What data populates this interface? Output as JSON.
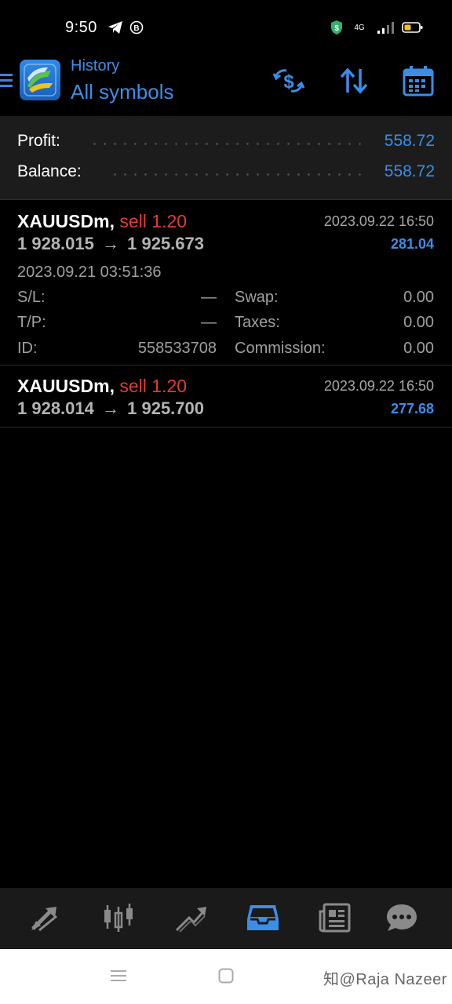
{
  "status_bar": {
    "time": "9:50",
    "network": "4G",
    "icons": [
      "telegram-icon",
      "b-circle-icon",
      "shield-icon",
      "signal-icon",
      "battery-icon"
    ]
  },
  "header": {
    "title": "History",
    "subtitle": "All symbols",
    "actions": [
      "deposit-icon",
      "sort-icon",
      "calendar-icon"
    ]
  },
  "summary": {
    "profit_label": "Profit:",
    "profit_value": "558.72",
    "balance_label": "Balance:",
    "balance_value": "558.72"
  },
  "trades": [
    {
      "symbol": "XAUUSDm",
      "separator": ",",
      "side": "sell 1.20",
      "open_price": "1 928.015",
      "arrow": "→",
      "close_price": "1 925.673",
      "close_time": "2023.09.22 16:50",
      "profit": "281.04",
      "open_time": "2023.09.21 03:51:36",
      "details": {
        "sl_label": "S/L:",
        "sl_value": "—",
        "tp_label": "T/P:",
        "tp_value": "—",
        "id_label": "ID:",
        "id_value": "558533708",
        "swap_label": "Swap:",
        "swap_value": "0.00",
        "taxes_label": "Taxes:",
        "taxes_value": "0.00",
        "commission_label": "Commission:",
        "commission_value": "0.00"
      }
    },
    {
      "symbol": "XAUUSDm",
      "separator": ",",
      "side": "sell 1.20",
      "open_price": "1 928.014",
      "arrow": "→",
      "close_price": "1 925.700",
      "close_time": "2023.09.22 16:50",
      "profit": "277.68"
    }
  ],
  "bottom_nav": {
    "items": [
      "quotes-icon",
      "chart-icon",
      "trade-icon",
      "history-icon",
      "news-icon",
      "chat-icon"
    ],
    "active": "history-icon"
  },
  "watermark": "知@Raja Nazeer",
  "colors": {
    "accent": "#3a8ee8",
    "sell": "#e23a3a",
    "background": "#000000",
    "panel": "#1c1c1c"
  }
}
